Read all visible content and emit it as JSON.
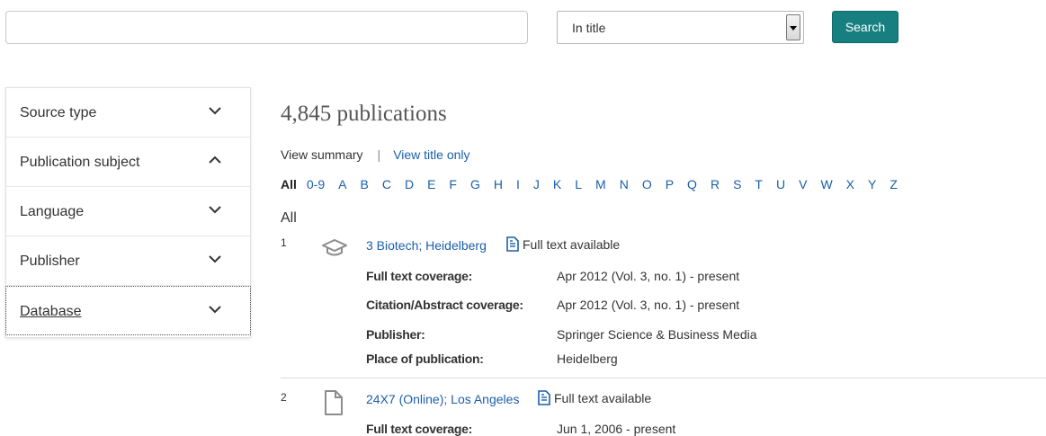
{
  "search": {
    "query": "",
    "scope_selected": "In title",
    "button_label": "Search"
  },
  "facets": [
    {
      "label": "Source type",
      "expanded": false
    },
    {
      "label": "Publication subject",
      "expanded": true
    },
    {
      "label": "Language",
      "expanded": false
    },
    {
      "label": "Publisher",
      "expanded": false
    },
    {
      "label": "Database",
      "expanded": false
    }
  ],
  "results_header": {
    "count": "4,845 publications",
    "view_summary": "View summary",
    "separator": "|",
    "view_title_only": "View title only",
    "section_label": "All"
  },
  "alphabet": [
    "All",
    "0-9",
    "A",
    "B",
    "C",
    "D",
    "E",
    "F",
    "G",
    "H",
    "I",
    "J",
    "K",
    "L",
    "M",
    "N",
    "O",
    "P",
    "Q",
    "R",
    "S",
    "T",
    "U",
    "V",
    "W",
    "X",
    "Y",
    "Z"
  ],
  "results": [
    {
      "index": "1",
      "icon": "scholarly-journal-icon",
      "title": "3 Biotech; Heidelberg",
      "fulltext_label": "Full text available",
      "fields": [
        {
          "label": "Full text coverage:",
          "value": "Apr 2012 (Vol. 3, no. 1) - present"
        },
        {
          "label": "Citation/Abstract coverage:",
          "value": "Apr 2012 (Vol. 3, no. 1) - present"
        },
        {
          "label": "Publisher:",
          "value": "Springer Science & Business Media"
        },
        {
          "label": "Place of publication:",
          "value": "Heidelberg"
        }
      ]
    },
    {
      "index": "2",
      "icon": "document-icon",
      "title": "24X7 (Online); Los Angeles",
      "fulltext_label": "Full text available",
      "fields": [
        {
          "label": "Full text coverage:",
          "value": "Jun 1, 2006 - present"
        }
      ]
    }
  ],
  "colors": {
    "link": "#1a5fab",
    "button": "#177f80",
    "text": "#333333"
  }
}
